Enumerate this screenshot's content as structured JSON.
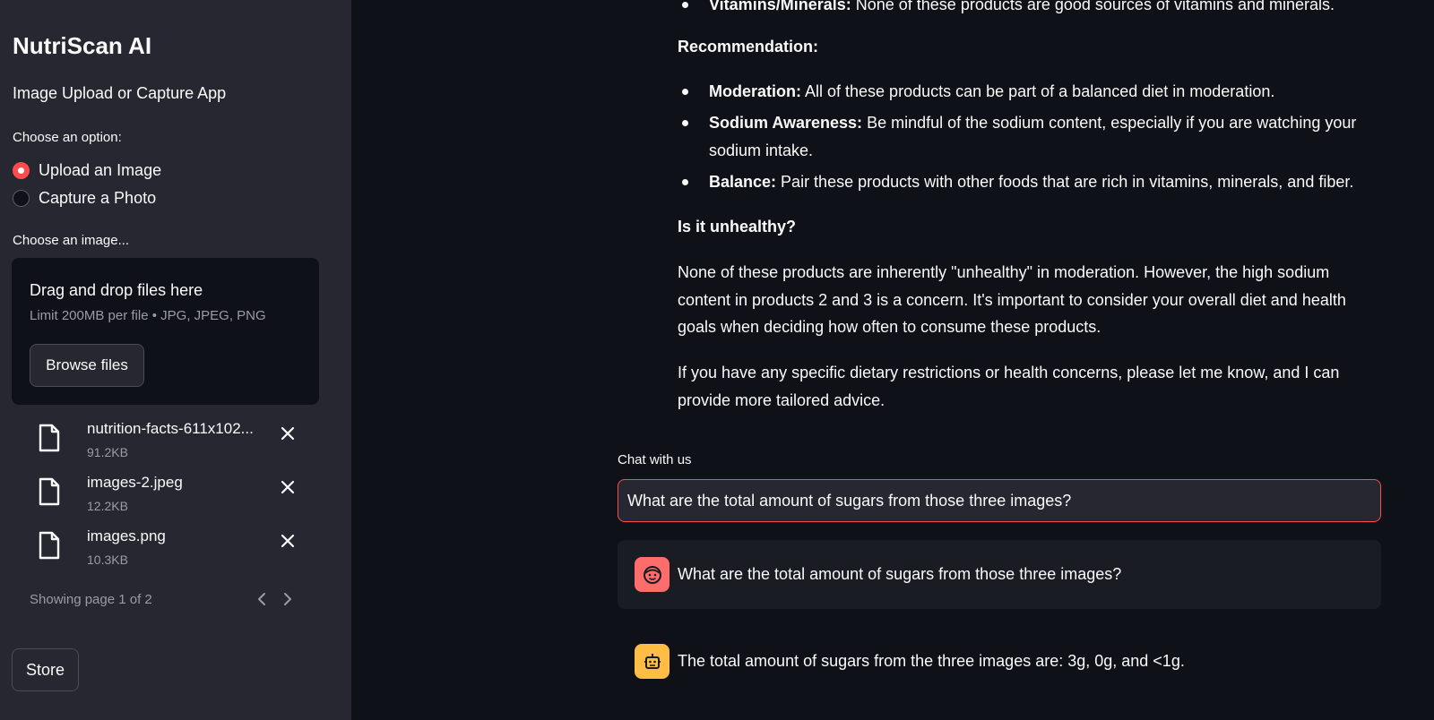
{
  "sidebar": {
    "title": "NutriScan AI",
    "subtitle": "Image Upload or Capture App",
    "radio_label": "Choose an option:",
    "options": [
      "Upload an Image",
      "Capture a Photo"
    ],
    "selected_option": "Upload an Image",
    "uploader_label": "Choose an image...",
    "dropzone_title": "Drag and drop files here",
    "dropzone_limit": "Limit 200MB per file • JPG, JPEG, PNG",
    "browse_label": "Browse files",
    "files": [
      {
        "name": "nutrition-facts-611x102...",
        "size": "91.2KB"
      },
      {
        "name": "images-2.jpeg",
        "size": "12.2KB"
      },
      {
        "name": "images.png",
        "size": "10.3KB"
      }
    ],
    "pager_text": "Showing page 1 of 2",
    "store_label": "Store"
  },
  "response": {
    "top_bullet_label": "Vitamins/Minerals:",
    "top_bullet_text": " None of these products are good sources of vitamins and minerals.",
    "recommendation_heading": "Recommendation:",
    "bullets": [
      {
        "label": "Moderation:",
        "text": " All of these products can be part of a balanced diet in moderation."
      },
      {
        "label": "Sodium Awareness:",
        "text": " Be mindful of the sodium content, especially if you are watching your sodium intake."
      },
      {
        "label": "Balance:",
        "text": " Pair these products with other foods that are rich in vitamins, minerals, and fiber."
      }
    ],
    "unhealthy_heading": "Is it unhealthy?",
    "paragraph1": "None of these products are inherently \"unhealthy\" in moderation. However, the high sodium content in products 2 and 3 is a concern. It's important to consider your overall diet and health goals when deciding how often to consume these products.",
    "paragraph2": "If you have any specific dietary restrictions or health concerns, please let me know, and I can provide more tailored advice."
  },
  "chat": {
    "label": "Chat with us",
    "input_value": "What are the total amount of sugars from those three images?",
    "messages": [
      {
        "role": "user",
        "text": "What are the total amount of sugars from those three images?"
      },
      {
        "role": "assistant",
        "text": "The total amount of sugars from the three images are: 3g, 0g, and <1g."
      }
    ]
  },
  "colors": {
    "accent": "#ff4b4b",
    "sidebar_bg": "#262730",
    "main_bg": "#0e1117",
    "user_avatar": "#ff6c6c",
    "bot_avatar": "#ffbd45"
  }
}
